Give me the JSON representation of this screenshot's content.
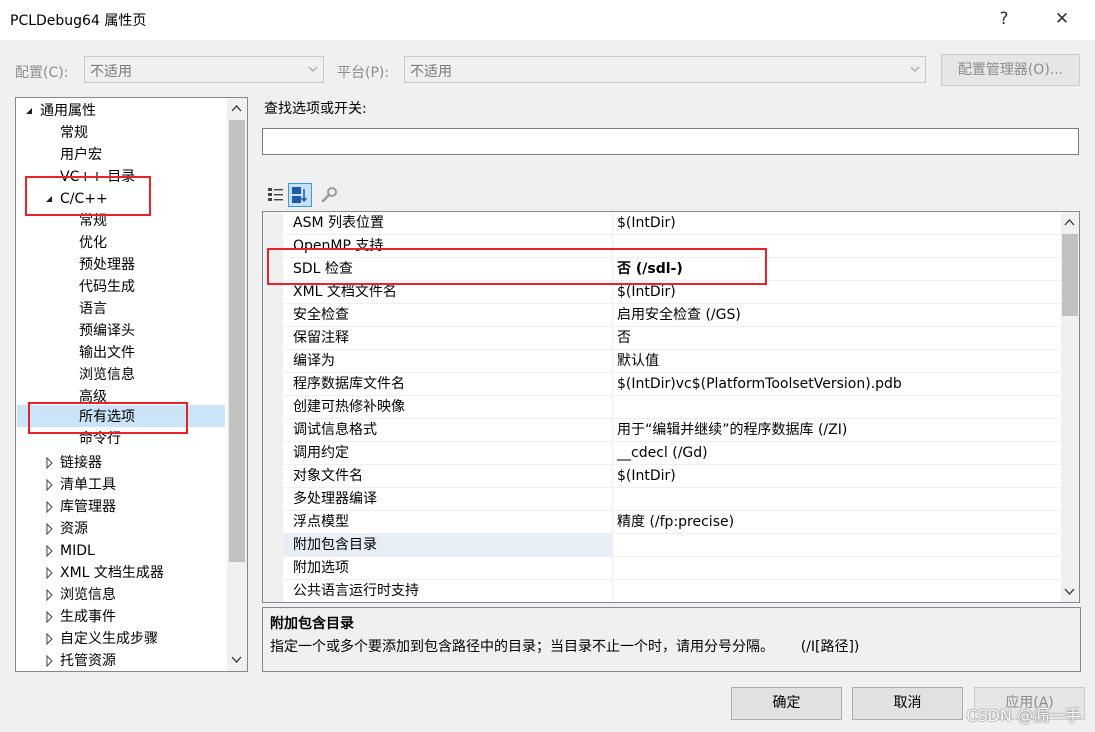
{
  "window": {
    "title": "PCLDebug64 属性页",
    "help_glyph": "?",
    "close_glyph": "✕"
  },
  "config_bar": {
    "config_label": "配置(C):",
    "config_value": "不适用",
    "platform_label": "平台(P):",
    "platform_value": "不适用",
    "manager_button": "配置管理器(O)..."
  },
  "tree": {
    "items": [
      {
        "label": "通用属性",
        "expander": "expanded"
      },
      {
        "label": "常规"
      },
      {
        "label": "用户宏"
      },
      {
        "label": "VC++ 目录"
      },
      {
        "label": "C/C++",
        "expander": "expanded"
      },
      {
        "label": "常规"
      },
      {
        "label": "优化"
      },
      {
        "label": "预处理器"
      },
      {
        "label": "代码生成"
      },
      {
        "label": "语言"
      },
      {
        "label": "预编译头"
      },
      {
        "label": "输出文件"
      },
      {
        "label": "浏览信息"
      },
      {
        "label": "高级"
      },
      {
        "label": "所有选项",
        "selected": true
      },
      {
        "label": "命令行"
      },
      {
        "label": "链接器",
        "expander": "collapsed"
      },
      {
        "label": "清单工具",
        "expander": "collapsed"
      },
      {
        "label": "库管理器",
        "expander": "collapsed"
      },
      {
        "label": "资源",
        "expander": "collapsed"
      },
      {
        "label": "MIDL",
        "expander": "collapsed"
      },
      {
        "label": "XML 文档生成器",
        "expander": "collapsed"
      },
      {
        "label": "浏览信息",
        "expander": "collapsed"
      },
      {
        "label": "生成事件",
        "expander": "collapsed"
      },
      {
        "label": "自定义生成步骤",
        "expander": "collapsed"
      },
      {
        "label": "托管资源",
        "expander": "collapsed"
      }
    ]
  },
  "search": {
    "label": "查找选项或开关:",
    "value": ""
  },
  "toolbar": {
    "icons": [
      "categorized-view-icon",
      "alphabetical-sort-icon",
      "property-pages-wrench-icon"
    ]
  },
  "properties": {
    "rows": [
      {
        "name": "ASM 列表位置",
        "value": "$(IntDir)"
      },
      {
        "name": "OpenMP 支持",
        "value": ""
      },
      {
        "name": "SDL 检查",
        "value": "否 (/sdl-)",
        "bold": true
      },
      {
        "name": "XML 文档文件名",
        "value": "$(IntDir)"
      },
      {
        "name": "安全检查",
        "value": "启用安全检查 (/GS)"
      },
      {
        "name": "保留注释",
        "value": "否"
      },
      {
        "name": "编译为",
        "value": "默认值"
      },
      {
        "name": "程序数据库文件名",
        "value": "$(IntDir)vc$(PlatformToolsetVersion).pdb"
      },
      {
        "name": "创建可热修补映像",
        "value": ""
      },
      {
        "name": "调试信息格式",
        "value": "用于“编辑并继续”的程序数据库 (/ZI)"
      },
      {
        "name": "调用约定",
        "value": "__cdecl (/Gd)"
      },
      {
        "name": "对象文件名",
        "value": "$(IntDir)"
      },
      {
        "name": "多处理器编译",
        "value": ""
      },
      {
        "name": "浮点模型",
        "value": "精度 (/fp:precise)"
      },
      {
        "name": "附加包含目录",
        "value": "",
        "selected": true
      },
      {
        "name": "附加选项",
        "value": ""
      },
      {
        "name": "公共语言运行时支持",
        "value": ""
      }
    ]
  },
  "description": {
    "title": "附加包含目录",
    "text": "指定一个或多个要添加到包含路径中的目录；当目录不止一个时，请用分号分隔。      (/I[路径])"
  },
  "buttons": {
    "ok": "确定",
    "cancel": "取消",
    "apply": "应用(A)"
  },
  "watermark": "CSDN @漏一手",
  "colors": {
    "highlight_box": "#e8242a",
    "selection": "#cce4f7"
  }
}
